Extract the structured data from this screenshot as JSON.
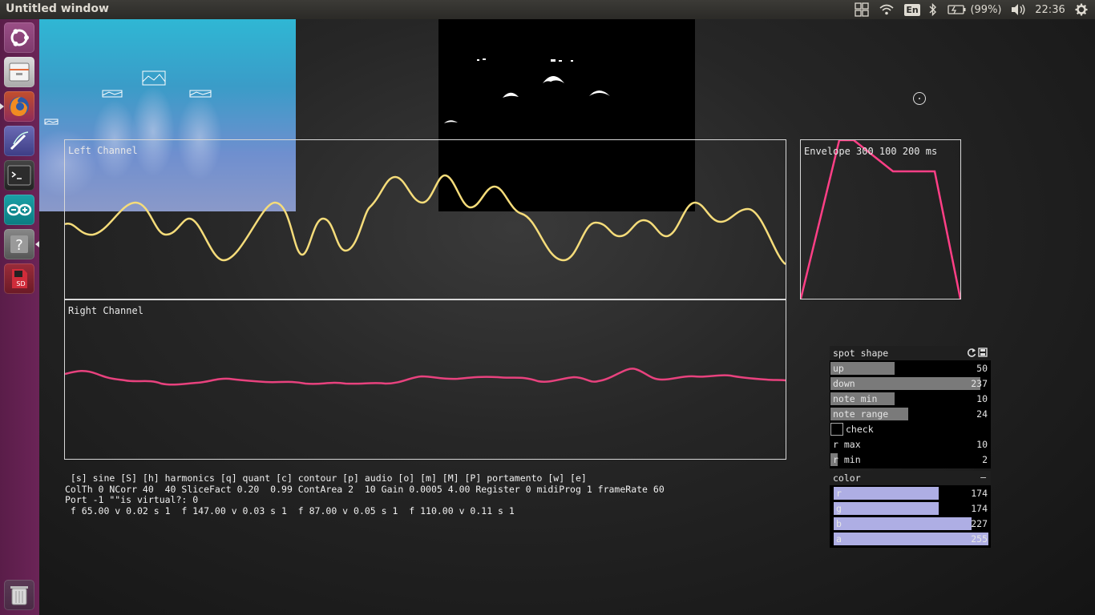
{
  "window": {
    "title": "Untitled window"
  },
  "topbar": {
    "keyboard_layout": "En",
    "battery_percent": "(99%)",
    "clock": "22:36"
  },
  "launcher": {
    "items": [
      "ubuntu-dash",
      "files",
      "firefox",
      "text-editor",
      "terminal",
      "arduino",
      "help",
      "sd-card"
    ],
    "trash": "trash"
  },
  "waveforms": {
    "left_channel_label": "Left Channel",
    "right_channel_label": "Right Channel",
    "left_color": "#f5dc7a",
    "right_color": "#e8427e",
    "envelope_label": "Envelope 300 100 200 ms",
    "envelope_color": "#ff3f86"
  },
  "status_lines": [
    " [s] sine [S] [h] harmonics [q] quant [c] contour [p] audio [o] [m] [M] [P] portamento [w] [e]",
    "ColTh 0 NCorr 40  40 SliceFact 0.20  0.99 ContArea 2  10 Gain 0.0005 4.00 Register 0 midiProg 1 frameRate 60",
    "Port -1 \"\"is virtual?: 0",
    " f 65.00 v 0.02 s 1  f 147.00 v 0.03 s 1  f 87.00 v 0.05 s 1  f 110.00 v 0.11 s 1"
  ],
  "spot_shape_panel": {
    "title": "spot shape",
    "sliders": [
      {
        "label": "up",
        "value": "50",
        "fill_fraction": 0.4
      },
      {
        "label": "down",
        "value": "237",
        "fill_fraction": 0.93
      },
      {
        "label": "note min",
        "value": "10",
        "fill_fraction": 0.4
      },
      {
        "label": "note range",
        "value": "24",
        "fill_fraction": 0.48
      }
    ],
    "toggle": {
      "label": "check",
      "checked": false
    },
    "extra_sliders": [
      {
        "label": "r max",
        "value": "10",
        "fill_fraction": 0.0
      },
      {
        "label": "r min",
        "value": "2",
        "fill_fraction": 0.05
      }
    ]
  },
  "color_panel": {
    "title": "color",
    "collapse_symbol": "–",
    "sliders": [
      {
        "label": "r",
        "value": "174",
        "fill_fraction": 0.68
      },
      {
        "label": "g",
        "value": "174",
        "fill_fraction": 0.68
      },
      {
        "label": "b",
        "value": "227",
        "fill_fraction": 0.89
      },
      {
        "label": "a",
        "value": "255",
        "fill_fraction": 1.0
      }
    ]
  }
}
